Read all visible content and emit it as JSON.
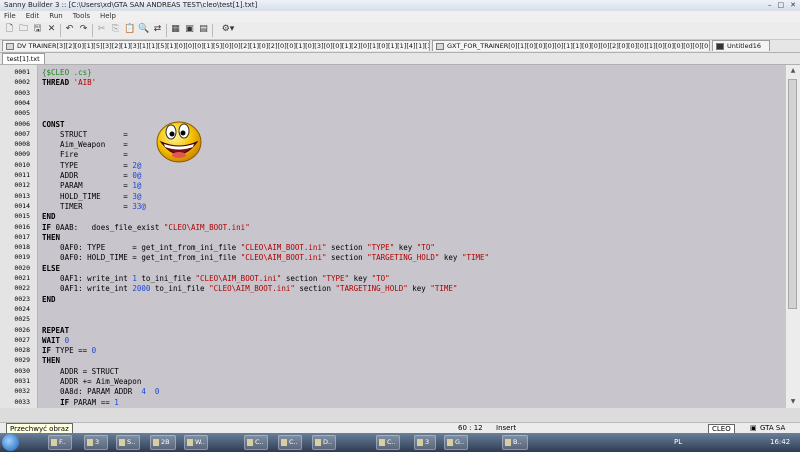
{
  "window": {
    "title": "Sanny Builder 3 :: [C:\\Users\\xd\\GTA SAN ANDREAS TEST\\cleo\\test[1].txt]",
    "controls": [
      "–",
      "□",
      "✕"
    ]
  },
  "menu": [
    "File",
    "Edit",
    "Run",
    "Tools",
    "Help"
  ],
  "tabs": [
    {
      "label": "DV TRAINER[3][2][0][1][5][3][2][1][3][1][1][5][1][0][0][0][1][5][0][0][2][1][0][2][0][0][1][0][3][0][0][1][2][0][1][0][1][1][4][1][3][0][0][0][0][2][1][0][2].txt",
      "active": false
    },
    {
      "label": "GXT_FOR_TRAINER[0][1][0][0][0][0][1][1][0][0][0][2][0][0][0][1][0][0][0][0][0][0][0][0].txt",
      "active": false
    },
    {
      "label": "Untitled16",
      "active": false
    }
  ],
  "subtab": "test[1].txt",
  "lines": [
    {
      "n": "0001",
      "text": "{$CLEO .cs}"
    },
    {
      "n": "0002",
      "text": "THREAD 'AIB'"
    },
    {
      "n": "0003",
      "text": ""
    },
    {
      "n": "0004",
      "text": ""
    },
    {
      "n": "0005",
      "text": ""
    },
    {
      "n": "0006",
      "text": "CONST"
    },
    {
      "n": "0007",
      "text": "    STRUCT        ="
    },
    {
      "n": "0008",
      "text": "    Aim_Weapon    ="
    },
    {
      "n": "0009",
      "text": "    Fire          ="
    },
    {
      "n": "0010",
      "text": "    TYPE          = 2@"
    },
    {
      "n": "0011",
      "text": "    ADDR          = 0@"
    },
    {
      "n": "0012",
      "text": "    PARAM         = 1@"
    },
    {
      "n": "0013",
      "text": "    HOLD_TIME     = 3@"
    },
    {
      "n": "0014",
      "text": "    TIMER         = 33@"
    },
    {
      "n": "0015",
      "text": "END"
    },
    {
      "n": "0016",
      "text": "IF 0AAB:   does_file_exist \"CLEO\\AIM_BOOT.ini\""
    },
    {
      "n": "0017",
      "text": "THEN"
    },
    {
      "n": "0018",
      "text": "    0AF0: TYPE      = get_int_from_ini_file \"CLEO\\AIM_BOOT.ini\" section \"TYPE\" key \"TO\""
    },
    {
      "n": "0019",
      "text": "    0AF0: HOLD_TIME = get_int_from_ini_file \"CLEO\\AIM_BOOT.ini\" section \"TARGETING_HOLD\" key \"TIME\""
    },
    {
      "n": "0020",
      "text": "ELSE"
    },
    {
      "n": "0021",
      "text": "    0AF1: write_int 1 to_ini_file \"CLEO\\AIM_BOOT.ini\" section \"TYPE\" key \"TO\""
    },
    {
      "n": "0022",
      "text": "    0AF1: write_int 2000 to_ini_file \"CLEO\\AIM_BOOT.ini\" section \"TARGETING_HOLD\" key \"TIME\""
    },
    {
      "n": "0023",
      "text": "END"
    },
    {
      "n": "0024",
      "text": ""
    },
    {
      "n": "0025",
      "text": ""
    },
    {
      "n": "0026",
      "text": "REPEAT"
    },
    {
      "n": "0027",
      "text": "WAIT 0"
    },
    {
      "n": "0028",
      "text": "IF TYPE == 0"
    },
    {
      "n": "0029",
      "text": "THEN"
    },
    {
      "n": "0030",
      "text": "    ADDR = STRUCT"
    },
    {
      "n": "0031",
      "text": "    ADDR += Aim_Weapon"
    },
    {
      "n": "0032",
      "text": "    0A8d: PARAM ADDR  4  0"
    },
    {
      "n": "0033",
      "text": "    IF PARAM == 1"
    }
  ],
  "status": {
    "position": "60 : 12",
    "mode": "Insert",
    "cleo": "CLEO",
    "game": "GTA SA"
  },
  "tooltip": "Przechwyć obraz",
  "taskbar": {
    "items": [
      "F..",
      "3",
      "S..",
      "2B",
      "W..",
      "C..",
      "C..",
      "D..",
      "C..",
      "3",
      "G..",
      "B.."
    ],
    "lang": "PL",
    "clock": "16:42"
  }
}
